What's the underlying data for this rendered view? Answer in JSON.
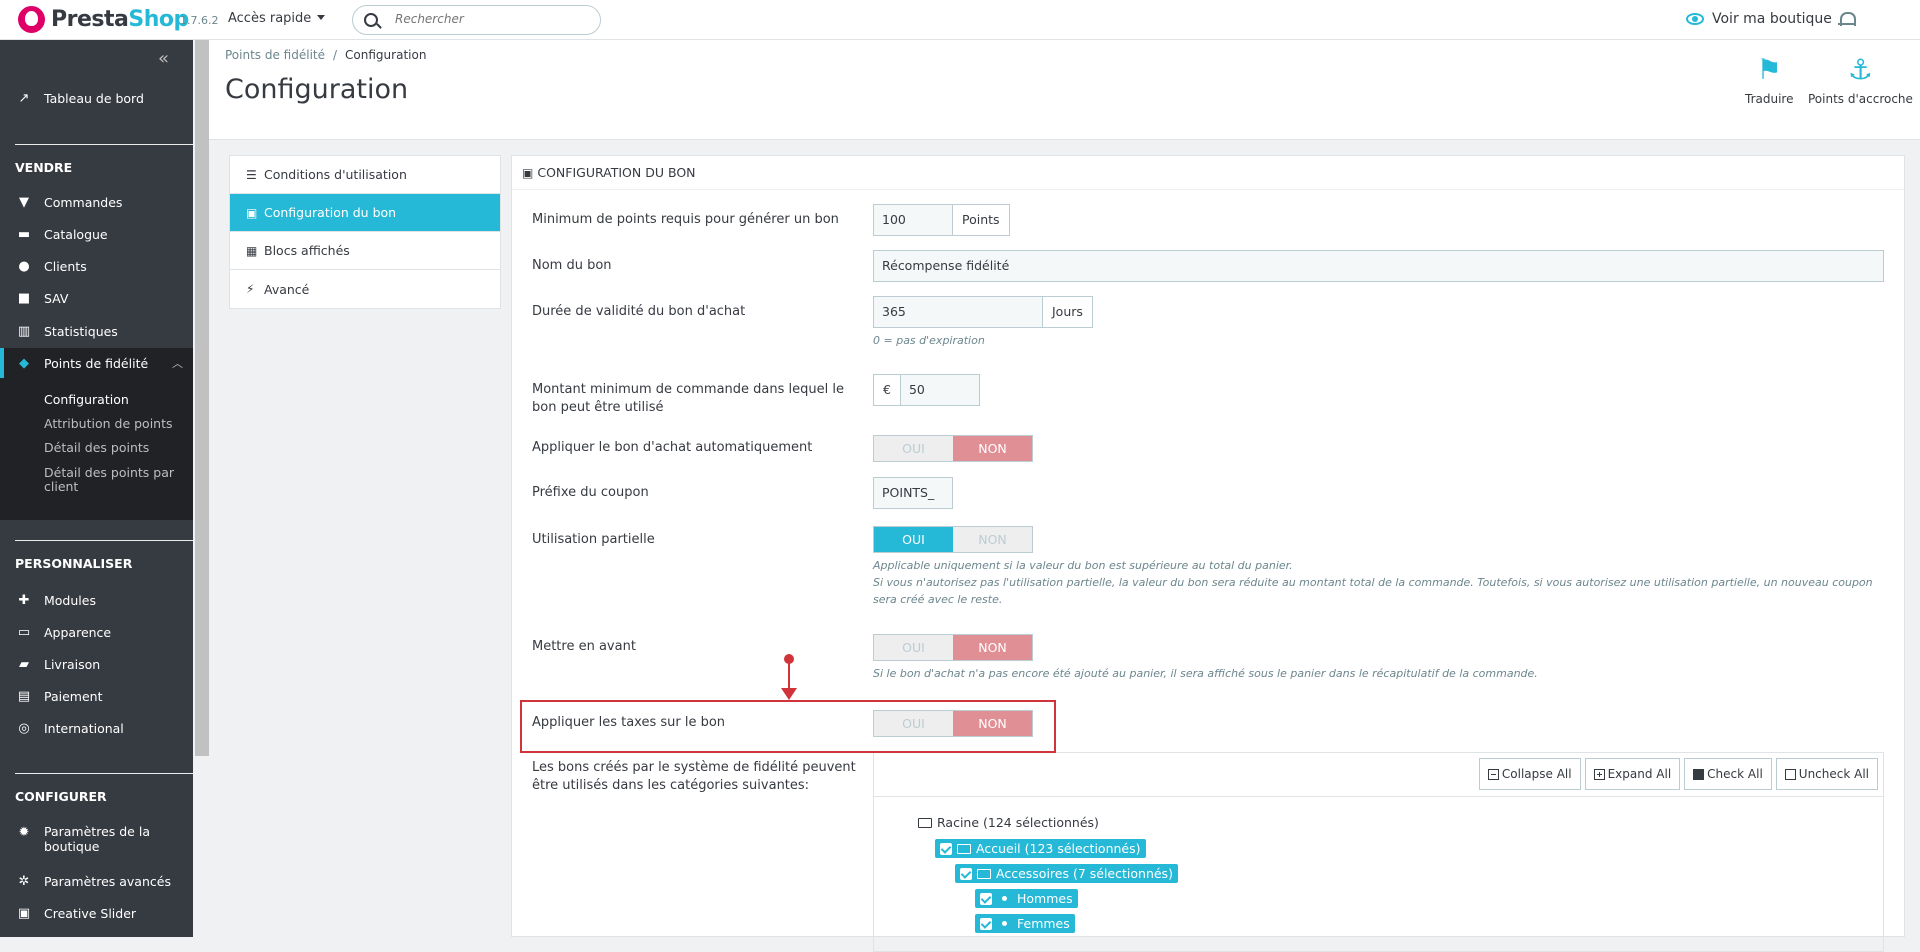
{
  "header": {
    "logo_prefix": "Presta",
    "logo_suffix": "Shop",
    "version": "1.7.6.2",
    "quick_access": "Accès rapide",
    "search_placeholder": "Rechercher",
    "view_shop": "Voir ma boutique"
  },
  "sidebar": {
    "collapse": "«",
    "dashboard": "Tableau de bord",
    "sections": {
      "sell": "VENDRE",
      "customize": "PERSONNALISER",
      "configure": "CONFIGURER"
    },
    "sell_items": [
      "Commandes",
      "Catalogue",
      "Clients",
      "SAV",
      "Statistiques",
      "Points de fidélité"
    ],
    "loyalty_sub": [
      "Configuration",
      "Attribution de points",
      "Détail des points",
      "Détail des points par client"
    ],
    "customize_items": [
      "Modules",
      "Apparence",
      "Livraison",
      "Paiement",
      "International"
    ],
    "configure_items": [
      "Paramètres de la boutique",
      "Paramètres avancés",
      "Creative Slider"
    ]
  },
  "page": {
    "breadcrumb": [
      "Points de fidélité",
      "Configuration"
    ],
    "breadcrumb_sep": "/",
    "title": "Configuration",
    "toolbar": {
      "translate": "Traduire",
      "hooks": "Points d'accroche"
    }
  },
  "tabs": [
    "Conditions d'utilisation",
    "Configuration du bon",
    "Blocs affichés",
    "Avancé"
  ],
  "form": {
    "panel_title": "CONFIGURATION DU BON",
    "min_points_label": "Minimum de points requis pour générer un bon",
    "min_points_value": "100",
    "min_points_unit": "Points",
    "voucher_name_label": "Nom du bon",
    "voucher_name_value": "Récompense fidélité",
    "validity_label": "Durée de validité du bon d'achat",
    "validity_value": "365",
    "validity_unit": "Jours",
    "validity_help": "0 = pas d'expiration",
    "min_order_label": "Montant minimum de commande dans lequel le bon peut être utilisé",
    "min_order_currency": "€",
    "min_order_value": "50",
    "auto_apply_label": "Appliquer le bon d'achat automatiquement",
    "prefix_label": "Préfixe du coupon",
    "prefix_value": "POINTS_",
    "partial_label": "Utilisation partielle",
    "partial_help_1": "Applicable uniquement si la valeur du bon est supérieure au total du panier.",
    "partial_help_2": "Si vous n'autorisez pas l'utilisation partielle, la valeur du bon sera réduite au montant total de la commande. Toutefois, si vous autorisez une utilisation partielle, un nouveau coupon sera créé avec le reste.",
    "highlight_label": "Mettre en avant",
    "highlight_help": "Si le bon d'achat n'a pas encore été ajouté au panier, il sera affiché sous le panier dans le récapitulatif de la commande.",
    "taxes_label": "Appliquer les taxes sur le bon",
    "categories_label": "Les bons créés par le système de fidélité peuvent être utilisés dans les catégories suivantes:",
    "yes": "OUI",
    "no": "NON"
  },
  "tree": {
    "collapse_all": "Collapse All",
    "expand_all": "Expand All",
    "check_all": "Check All",
    "uncheck_all": "Uncheck All",
    "root": "Racine (124 sélectionnés)",
    "home": "Accueil (123 sélectionnés)",
    "accessories": "Accessoires (7 sélectionnés)",
    "men": "Hommes",
    "women": "Femmes"
  },
  "colors": {
    "accent": "#25b9d7",
    "sidebar": "#363a41",
    "no_active": "#e08f95",
    "annotation": "#d0343a"
  }
}
